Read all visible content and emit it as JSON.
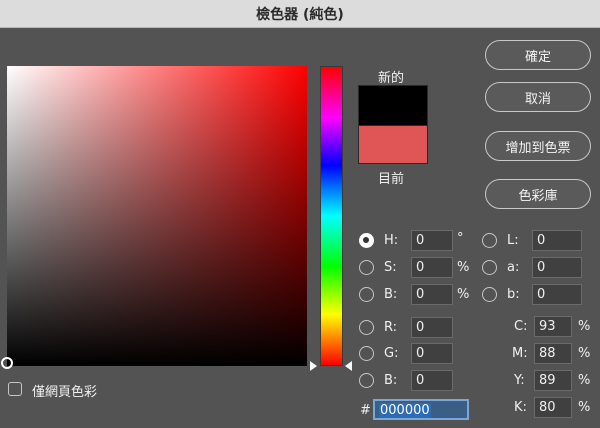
{
  "window": {
    "title": "檢色器 (純色)"
  },
  "preview": {
    "new_label": "新的",
    "current_label": "目前"
  },
  "buttons": {
    "ok": "確定",
    "cancel": "取消",
    "add_swatch": "增加到色票",
    "libraries": "色彩庫"
  },
  "hsb": {
    "h": {
      "label": "H:",
      "value": "0",
      "unit": "°",
      "selected": true
    },
    "s": {
      "label": "S:",
      "value": "0",
      "unit": "%"
    },
    "b": {
      "label": "B:",
      "value": "0",
      "unit": "%"
    }
  },
  "lab": {
    "l": {
      "label": "L:",
      "value": "0"
    },
    "a": {
      "label": "a:",
      "value": "0"
    },
    "b": {
      "label": "b:",
      "value": "0"
    }
  },
  "rgb": {
    "r": {
      "label": "R:",
      "value": "0"
    },
    "g": {
      "label": "G:",
      "value": "0"
    },
    "b": {
      "label": "B:",
      "value": "0"
    }
  },
  "cmyk": {
    "c": {
      "label": "C:",
      "value": "93",
      "unit": "%"
    },
    "m": {
      "label": "M:",
      "value": "88",
      "unit": "%"
    },
    "y": {
      "label": "Y:",
      "value": "89",
      "unit": "%"
    },
    "k": {
      "label": "K:",
      "value": "80",
      "unit": "%"
    }
  },
  "hex": {
    "label": "#",
    "value": "000000"
  },
  "web_only": {
    "label": "僅網頁色彩",
    "checked": false
  },
  "colors": {
    "new": "#000000",
    "current": "#e05555",
    "accent": "#2e6bb5"
  }
}
